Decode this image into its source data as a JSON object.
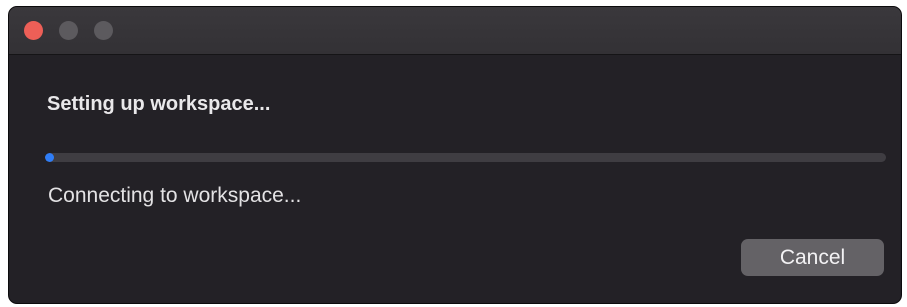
{
  "window": {
    "traffic_lights": [
      {
        "name": "close",
        "color": "#ed5f57"
      },
      {
        "name": "minimize",
        "color": "#5c5a5e"
      },
      {
        "name": "zoom",
        "color": "#5c5a5e"
      }
    ]
  },
  "dialog": {
    "title": "Setting up workspace...",
    "status": "Connecting to workspace...",
    "progress_fraction": 0.01,
    "progress_color": "#2f7df6",
    "cancel_label": "Cancel"
  }
}
